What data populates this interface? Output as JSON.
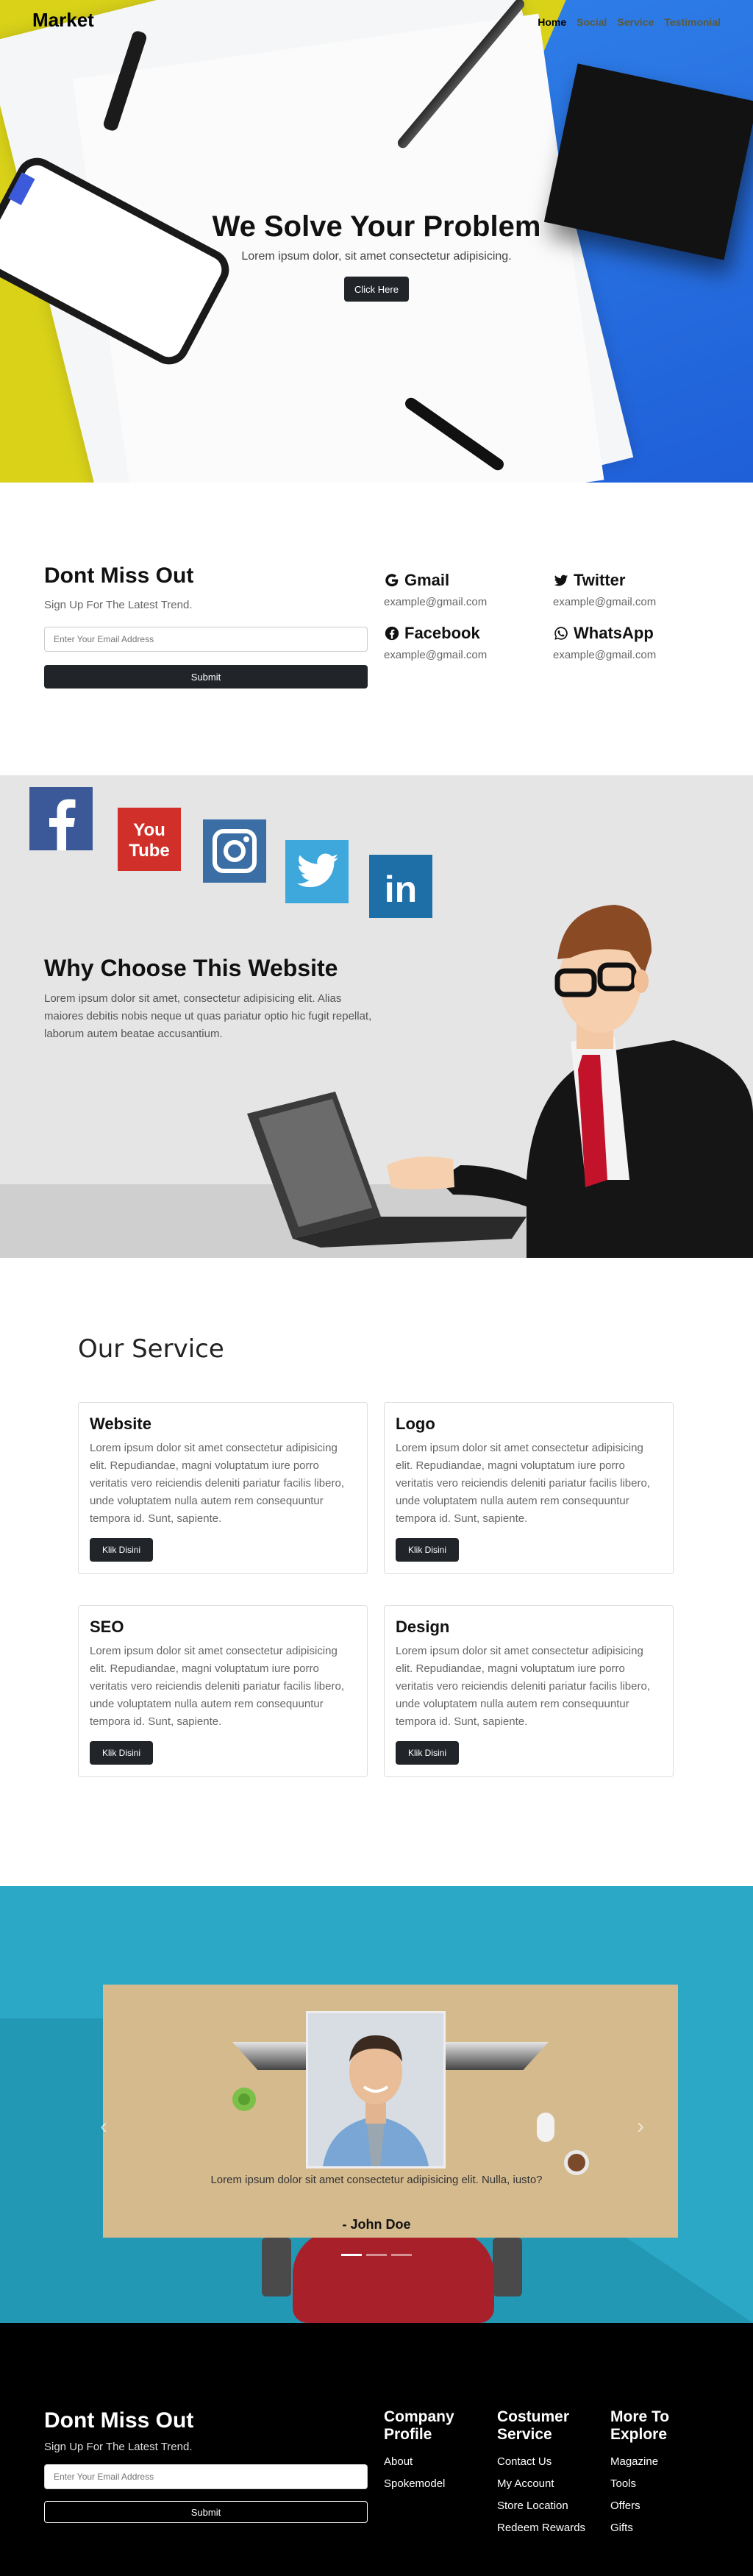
{
  "nav": {
    "brand": "Market",
    "links": [
      "Home",
      "Social",
      "Service",
      "Testimonial"
    ]
  },
  "hero": {
    "title": "We Solve Your Problem",
    "subtitle": "Lorem ipsum dolor, sit amet consectetur adipisicing.",
    "button": "Click Here"
  },
  "newsletter": {
    "title": "Dont Miss Out",
    "subtitle": "Sign Up For The Latest Trend.",
    "placeholder": "Enter Your Email Address",
    "button": "Submit"
  },
  "contacts": [
    {
      "name": "Gmail",
      "icon": "google-icon",
      "email": "example@gmail.com"
    },
    {
      "name": "Twitter",
      "icon": "twitter-icon",
      "email": "example@gmail.com"
    },
    {
      "name": "Facebook",
      "icon": "facebook-icon",
      "email": "example@gmail.com"
    },
    {
      "name": "WhatsApp",
      "icon": "whatsapp-icon",
      "email": "example@gmail.com"
    }
  ],
  "why": {
    "title": "Why Choose This Website",
    "text": "Lorem ipsum dolor sit amet, consectetur adipisicing elit. Alias maiores debitis nobis neque ut quas pariatur optio hic fugit repellat, laborum autem beatae accusantium.",
    "social_icons": [
      "facebook-icon",
      "youtube-icon",
      "instagram-icon",
      "twitter-icon",
      "linkedin-icon"
    ],
    "youtube_text": [
      "You",
      "Tube"
    ],
    "linkedin_text": "in"
  },
  "services": {
    "title": "Our Service",
    "cards": [
      {
        "title": "Website",
        "text": "Lorem ipsum dolor sit amet consectetur adipisicing elit. Repudiandae, magni voluptatum iure porro veritatis vero reiciendis deleniti pariatur facilis libero, unde voluptatem nulla autem rem consequuntur tempora id. Sunt, sapiente.",
        "button": "Klik Disini"
      },
      {
        "title": "Logo",
        "text": "Lorem ipsum dolor sit amet consectetur adipisicing elit. Repudiandae, magni voluptatum iure porro veritatis vero reiciendis deleniti pariatur facilis libero, unde voluptatem nulla autem rem consequuntur tempora id. Sunt, sapiente.",
        "button": "Klik Disini"
      },
      {
        "title": "SEO",
        "text": "Lorem ipsum dolor sit amet consectetur adipisicing elit. Repudiandae, magni voluptatum iure porro veritatis vero reiciendis deleniti pariatur facilis libero, unde voluptatem nulla autem rem consequuntur tempora id. Sunt, sapiente.",
        "button": "Klik Disini"
      },
      {
        "title": "Design",
        "text": "Lorem ipsum dolor sit amet consectetur adipisicing elit. Repudiandae, magni voluptatum iure porro veritatis vero reiciendis deleniti pariatur facilis libero, unde voluptatem nulla autem rem consequuntur tempora id. Sunt, sapiente.",
        "button": "Klik Disini"
      }
    ]
  },
  "testimonial": {
    "quote": "Lorem ipsum dolor sit amet consectetur adipisicing elit. Nulla, iusto?",
    "name": "- John Doe",
    "prev_icon": "chevron-left-icon",
    "next_icon": "chevron-right-icon"
  },
  "footer": {
    "title": "Dont Miss Out",
    "subtitle": "Sign Up For The Latest Trend.",
    "placeholder": "Enter Your Email Address",
    "button": "Submit",
    "columns": [
      {
        "title": "Company Profile",
        "items": [
          "About",
          "Spokemodel"
        ]
      },
      {
        "title": "Costumer Service",
        "items": [
          "Contact Us",
          "My Account",
          "Store Location",
          "Redeem Rewards"
        ]
      },
      {
        "title": "More To Explore",
        "items": [
          "Magazine",
          "Tools",
          "Offers",
          "Gifts"
        ]
      }
    ]
  },
  "colors": {
    "dark_button": "#212529",
    "hero_yellow": "#d9d219",
    "hero_blue": "#2f7fe8",
    "why_bg": "#e5e5e6",
    "testimonial_bg": "#2aa8c6",
    "footer_bg": "#000000"
  }
}
